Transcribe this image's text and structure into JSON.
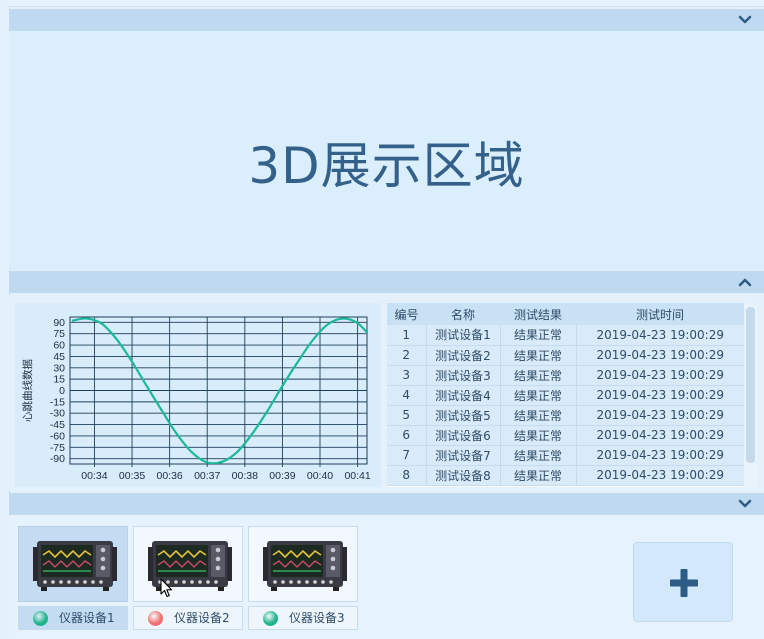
{
  "panel_3d": {
    "title": "3D展示区域"
  },
  "collapse_icons": {
    "top": "chevron-down-icon",
    "middle": "chevron-up-icon",
    "bottom": "chevron-down-icon"
  },
  "chart_data": {
    "type": "line",
    "ylabel": "心跳曲线数据",
    "xlabel": "",
    "title": "",
    "x_ticks": [
      "00:34",
      "00:35",
      "00:36",
      "00:37",
      "00:38",
      "00:39",
      "00:40",
      "00:41"
    ],
    "y_ticks": [
      90,
      75,
      60,
      45,
      30,
      15,
      0,
      -15,
      -30,
      -45,
      -60,
      -75,
      -90
    ],
    "ylim": [
      -97,
      97
    ],
    "grid": true,
    "series": [
      {
        "color": "#1bb99a",
        "x": [
          "00:33.4",
          "00:33.8",
          "00:34.2",
          "00:34.6",
          "00:35.0",
          "00:35.4",
          "00:35.8",
          "00:36.2",
          "00:36.6",
          "00:37.0",
          "00:37.4",
          "00:37.8",
          "00:38.2",
          "00:38.6",
          "00:39.0",
          "00:39.4",
          "00:39.8",
          "00:40.2",
          "00:40.6",
          "00:41.0",
          "00:41.4"
        ],
        "values": [
          92,
          95,
          88,
          67,
          38,
          5,
          -27,
          -58,
          -82,
          -95,
          -94,
          -81,
          -57,
          -27,
          6,
          37,
          66,
          87,
          95,
          89,
          68
        ]
      }
    ]
  },
  "table": {
    "columns": [
      "编号",
      "名称",
      "测试结果",
      "测试时间"
    ],
    "rows": [
      [
        "1",
        "测试设备1",
        "结果正常",
        "2019-04-23 19:00:29"
      ],
      [
        "2",
        "测试设备2",
        "结果正常",
        "2019-04-23 19:00:29"
      ],
      [
        "3",
        "测试设备3",
        "结果正常",
        "2019-04-23 19:00:29"
      ],
      [
        "4",
        "测试设备4",
        "结果正常",
        "2019-04-23 19:00:29"
      ],
      [
        "5",
        "测试设备5",
        "结果正常",
        "2019-04-23 19:00:29"
      ],
      [
        "6",
        "测试设备6",
        "结果正常",
        "2019-04-23 19:00:29"
      ],
      [
        "7",
        "测试设备7",
        "结果正常",
        "2019-04-23 19:00:29"
      ],
      [
        "8",
        "测试设备8",
        "结果正常",
        "2019-04-23 19:00:29"
      ]
    ]
  },
  "devices": [
    {
      "name": "仪器设备1",
      "status_color": "#1fb38a",
      "selected": true
    },
    {
      "name": "仪器设备2",
      "status_color": "#f07070",
      "selected": false
    },
    {
      "name": "仪器设备3",
      "status_color": "#1fb38a",
      "selected": false
    }
  ],
  "add_button": {
    "icon": "plus-icon"
  },
  "colors": {
    "accent": "#34618a",
    "line": "#1bb99a"
  }
}
